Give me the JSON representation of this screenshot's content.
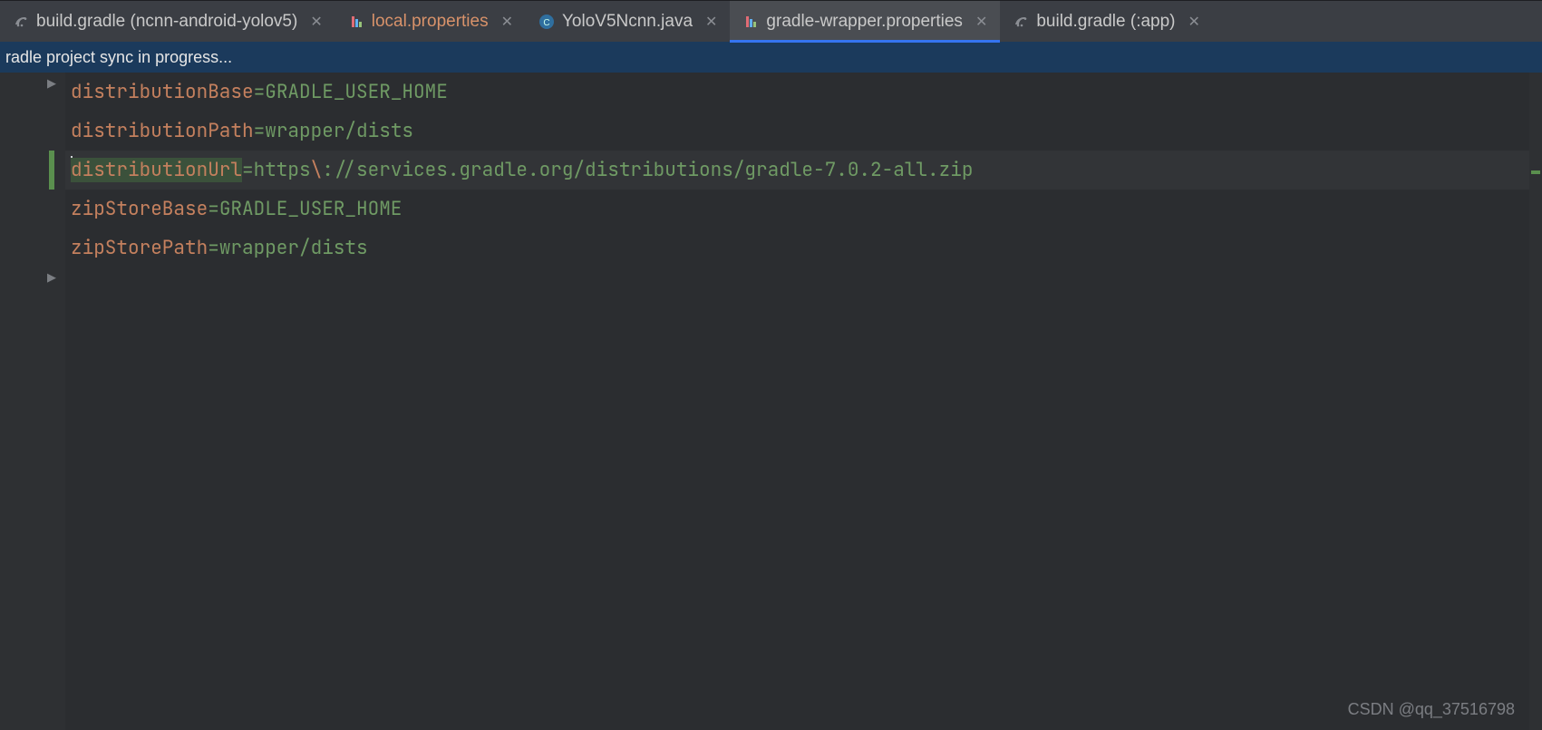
{
  "tabs": [
    {
      "label": "build.gradle (ncnn-android-yolov5)",
      "icon": "gradle",
      "modified": false,
      "active": false
    },
    {
      "label": "local.properties",
      "icon": "properties",
      "modified": true,
      "active": false
    },
    {
      "label": "YoloV5Ncnn.java",
      "icon": "java",
      "modified": false,
      "active": false
    },
    {
      "label": "gradle-wrapper.properties",
      "icon": "properties",
      "modified": false,
      "active": true
    },
    {
      "label": "build.gradle (:app)",
      "icon": "gradle",
      "modified": false,
      "active": false
    }
  ],
  "notification": "radle project sync in progress...",
  "code_lines": [
    {
      "key": "distributionBase",
      "val": "GRADLE_USER_HOME",
      "current": false
    },
    {
      "key": "distributionPath",
      "val": "wrapper/dists",
      "current": false
    },
    {
      "key": "distributionUrl",
      "val_parts": [
        {
          "t": "https",
          "cls": "val"
        },
        {
          "t": "\\",
          "cls": "esc"
        },
        {
          "t": "://services.gradle.org/distributions/gradle-7.0.2-all.zip",
          "cls": "val"
        }
      ],
      "current": true
    },
    {
      "key": "zipStoreBase",
      "val": "GRADLE_USER_HOME",
      "current": false
    },
    {
      "key": "zipStorePath",
      "val": "wrapper/dists",
      "current": false
    }
  ],
  "watermark": "CSDN @qq_37516798"
}
